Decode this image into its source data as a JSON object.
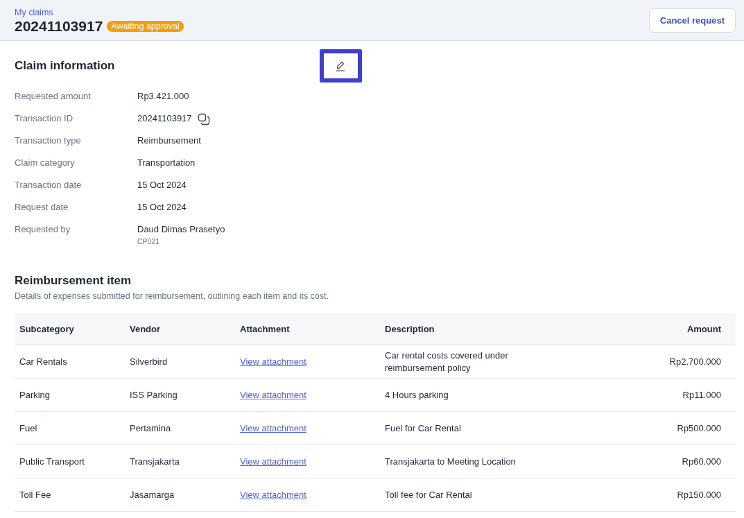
{
  "header": {
    "breadcrumb": "My claims",
    "title": "20241103917",
    "status": "Awaiting approval",
    "cancel_button": "Cancel request"
  },
  "claim_info": {
    "title": "Claim information",
    "fields": [
      {
        "label": "Requested amount",
        "value": "Rp3.421.000"
      },
      {
        "label": "Transaction ID",
        "value": "20241103917",
        "kind": "copy"
      },
      {
        "label": "Transaction type",
        "value": "Reimbursement"
      },
      {
        "label": "Claim category",
        "value": "Transportation"
      },
      {
        "label": "Transaction date",
        "value": "15 Oct 2024"
      },
      {
        "label": "Request date",
        "value": "15 Oct 2024"
      },
      {
        "label": "Requested by",
        "value": "Daud Dimas Prasetyo",
        "sub": "CP021",
        "kind": "person"
      }
    ]
  },
  "reimbursement": {
    "title": "Reimbursement item",
    "subtitle": "Details of expenses submitted for reimbursement, outlining each item and its cost.",
    "columns": [
      "Subcategory",
      "Vendor",
      "Attachment",
      "Description",
      "Amount"
    ],
    "rows": [
      {
        "subcategory": "Car Rentals",
        "vendor": "Silverbird",
        "attachment": "View attachment",
        "description": "Car rental costs covered under reimbursement policy",
        "amount": "Rp2.700.000"
      },
      {
        "subcategory": "Parking",
        "vendor": "ISS Parking",
        "attachment": "View attachment",
        "description": "4 Hours parking",
        "amount": "Rp11.000"
      },
      {
        "subcategory": "Fuel",
        "vendor": "Pertamina",
        "attachment": "View attachment",
        "description": "Fuel for Car Rental",
        "amount": "Rp500.000"
      },
      {
        "subcategory": "Public Transport",
        "vendor": "Transjakarta",
        "attachment": "View attachment",
        "description": "Transjakarta to Meeting Location",
        "amount": "Rp60.000"
      },
      {
        "subcategory": "Toll Fee",
        "vendor": "Jasamarga",
        "attachment": "View attachment",
        "description": "Toll fee for Car Rental",
        "amount": "Rp150.000"
      }
    ]
  }
}
